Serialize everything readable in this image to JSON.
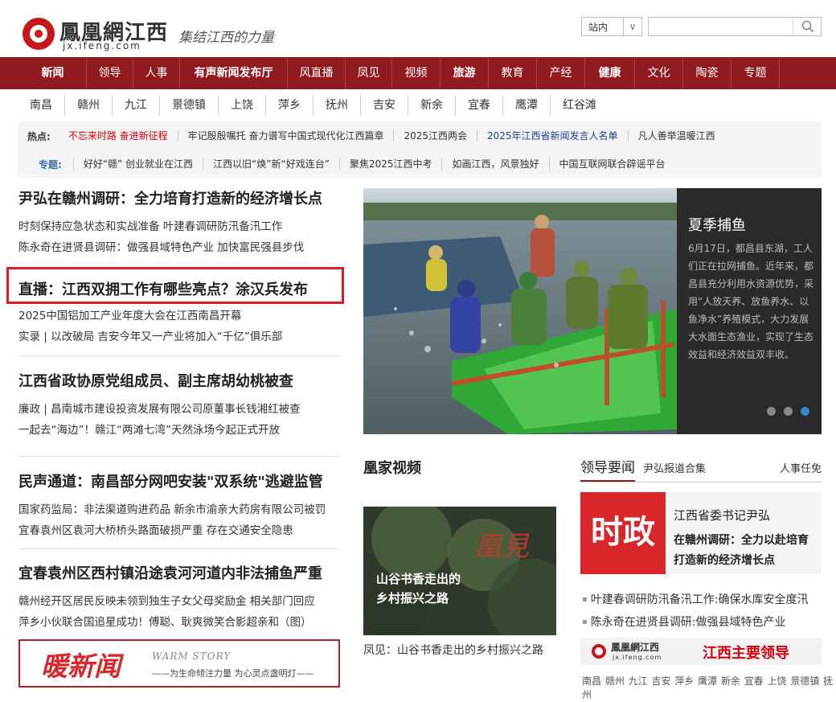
{
  "header": {
    "logo_name": "鳳凰網江西",
    "logo_domain": "jx.ifeng.com",
    "slogan": "集结江西的力量",
    "search_scope": "站内",
    "search_placeholder": ""
  },
  "main_nav": [
    "新闻",
    "领导",
    "人事",
    "有声新闻发布厅",
    "风直播",
    "凤见",
    "视频",
    "旅游",
    "教育",
    "产经",
    "健康",
    "文化",
    "陶瓷",
    "专题"
  ],
  "city_nav": [
    "南昌",
    "赣州",
    "九江",
    "景德镇",
    "上饶",
    "萍乡",
    "抚州",
    "吉安",
    "新余",
    "宜春",
    "鹰潭",
    "红谷滩"
  ],
  "hot": {
    "label": "热点:",
    "items": [
      "不忘来时路 奋进新征程",
      "牢记殷殷嘱托 奋力谱写中国式现代化江西篇章",
      "2025江西两会",
      "2025年江西省新闻发言人名单",
      "凡人善举温暖江西"
    ]
  },
  "topics": {
    "label": "专题:",
    "items": [
      "好好“赣” 创业就业在江西",
      "江西以旧“焕”新“好戏连台”",
      "聚焦2025江西中考",
      "如画江西，风景独好",
      "中国互联网联合辟谣平台"
    ]
  },
  "left_news": [
    {
      "headline": "尹弘在赣州调研：全力培育打造新的经济增长点",
      "lines": [
        "时刻保持应急状态和实战准备 叶建春调研防汛备汛工作",
        "陈永奇在进贤县调研：做强县域特色产业 加快富民强县步伐"
      ]
    },
    {
      "headline": "直播：江西双拥工作有哪些亮点？涂汉兵发布",
      "lines": [
        "2025中国铝加工产业年度大会在江西南昌开幕",
        "实录 | 以改破局 吉安今年又一产业将加入“千亿”俱乐部"
      ]
    },
    {
      "headline": "江西省政协原党组成员、副主席胡幼桃被查",
      "lines": [
        "廉政 | 昌南城市建设投资发展有限公司原董事长钱湘红被查",
        "一起去“海边”！赣江“两滩七湾”天然泳场今起正式开放"
      ]
    },
    {
      "headline": "民声通道：南昌部分网吧安装\"双系统\"逃避监管",
      "lines": [
        "国家药监局：非法渠道购进药品 新余市渝亲大药房有限公司被罚",
        "宜春袁州区袁河大桥桥头路面破损严重 存在交通安全隐患"
      ]
    },
    {
      "headline": "宜春袁州区西村镇沿途袁河河道内非法捕鱼严重",
      "lines": [
        "赣州经开区居民反映未领到独生子女父母奖励金 相关部门回应",
        "萍乡小伙联合国追星成功！傅聪、耿爽微笑合影超亲和（图）"
      ]
    }
  ],
  "banner": {
    "title": "暖新闻",
    "en": "WARM STORY",
    "sub": "——为生命倾注力量 为心灵点盏明灯——"
  },
  "slider": {
    "title": "夏季捕鱼",
    "desc": "6月17日，都昌县东湖，工人们正在拉网捕鱼。近年来，都昌县充分利用水资源优势，采用“人放天养、放鱼养水、以鱼净水”养殖模式，大力发展大水面生态渔业，实现了生态效益和经济效益双丰收。",
    "slide_count": 3,
    "active_slide": 3
  },
  "video": {
    "section_title": "凰家视频",
    "overlay_text_1": "山谷书香走出的",
    "overlay_text_2": "乡村振兴之路",
    "logo": "凰見",
    "caption": "凤见：山谷书香走出的乡村振兴之路"
  },
  "right": {
    "tab_active": "领导要闻",
    "tab_2": "尹弘报道合集",
    "tab_3": "人事任免",
    "badge": "时政",
    "feature_1": "江西省委书记尹弘",
    "feature_2": "在赣州调研：全力以赴培育打造新的经济增长点",
    "list": [
      "叶建春调研防汛备汛工作:确保水库安全度汛",
      "陈永奇在进贤县调研:做强县域特色产业"
    ],
    "leaders_logo": "鳳凰網江西",
    "leaders_domain": "jx.ifeng.com",
    "leaders_label": "江西主要领导",
    "cities": "南昌 赣州 九江 吉安 萍乡 鹰潭 新余 宜春 上饶 景德镇 抚州"
  }
}
